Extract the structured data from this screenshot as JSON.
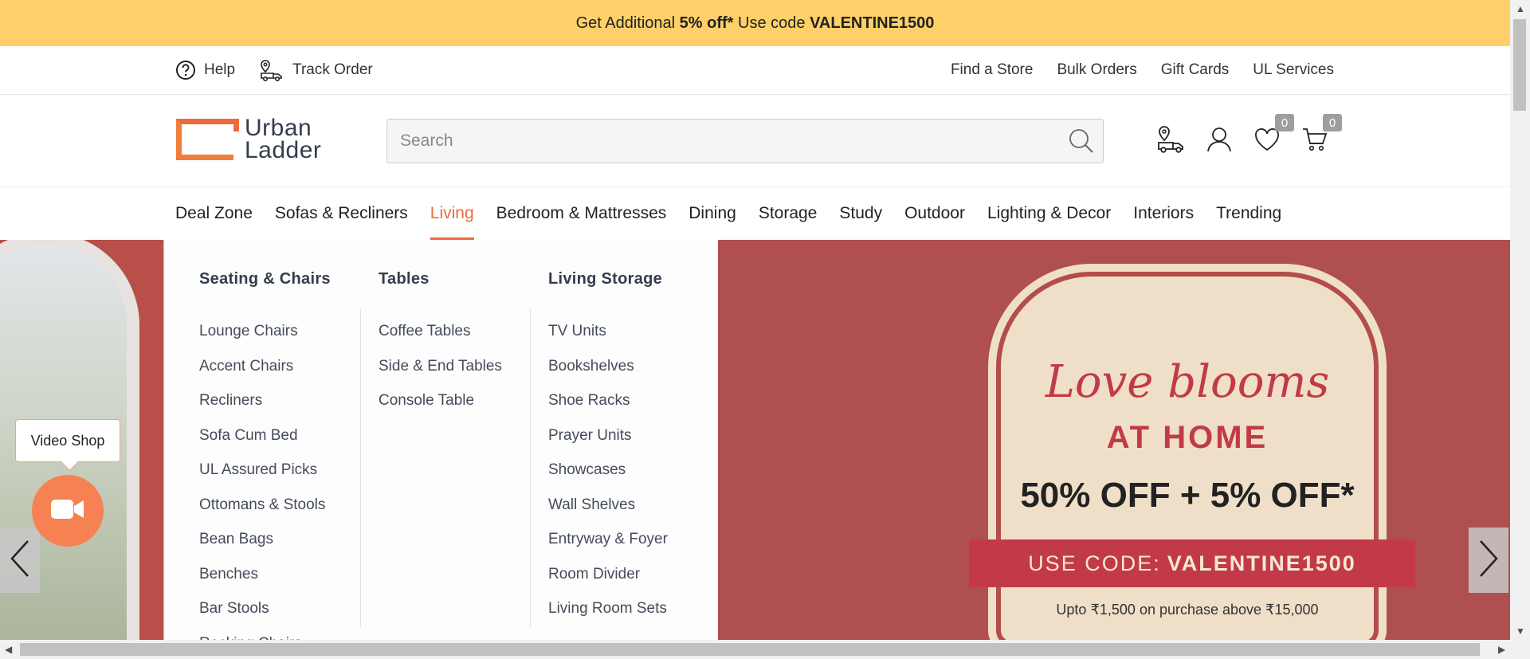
{
  "promo": {
    "prefix": "Get Additional ",
    "bold1": "5% off*",
    "middle": " Use code ",
    "bold2": "VALENTINE1500"
  },
  "utility": {
    "help": "Help",
    "track_order": "Track Order",
    "find_store": "Find a Store",
    "bulk_orders": "Bulk Orders",
    "gift_cards": "Gift Cards",
    "ul_services": "UL Services"
  },
  "logo": {
    "line1": "Urban",
    "line2": "Ladder"
  },
  "search": {
    "placeholder": "Search",
    "value": ""
  },
  "header_icons": {
    "wishlist_count": "0",
    "cart_count": "0"
  },
  "nav": [
    {
      "label": "Deal Zone"
    },
    {
      "label": "Sofas & Recliners"
    },
    {
      "label": "Living",
      "active": true
    },
    {
      "label": "Bedroom & Mattresses"
    },
    {
      "label": "Dining"
    },
    {
      "label": "Storage"
    },
    {
      "label": "Study"
    },
    {
      "label": "Outdoor"
    },
    {
      "label": "Lighting & Decor"
    },
    {
      "label": "Interiors"
    },
    {
      "label": "Trending"
    }
  ],
  "mega_menu": {
    "columns": [
      {
        "title": "Seating & Chairs",
        "items": [
          "Lounge Chairs",
          "Accent Chairs",
          "Recliners",
          "Sofa Cum Bed",
          "UL Assured Picks",
          "Ottomans & Stools",
          "Bean Bags",
          "Benches",
          "Bar Stools",
          "Rocking Chairs"
        ]
      },
      {
        "title": "Tables",
        "items": [
          "Coffee Tables",
          "Side & End Tables",
          "Console Table"
        ]
      },
      {
        "title": "Living Storage",
        "items": [
          "TV Units",
          "Bookshelves",
          "Shoe Racks",
          "Prayer Units",
          "Showcases",
          "Wall Shelves",
          "Entryway & Foyer",
          "Room Divider",
          "Living Room Sets"
        ]
      }
    ]
  },
  "banner": {
    "headline": "Love blooms",
    "subhead": "AT HOME",
    "offer": "50% OFF + 5% OFF*",
    "code_prefix": "USE CODE:",
    "code": "VALENTINE1500",
    "fineprint": "Upto ₹1,500 on purchase above  ₹15,000"
  },
  "video_shop": {
    "label": "Video Shop"
  },
  "colors": {
    "promo_bg": "#ffd069",
    "accent": "#ee6a3c",
    "banner_bg": "#b04f4f"
  }
}
